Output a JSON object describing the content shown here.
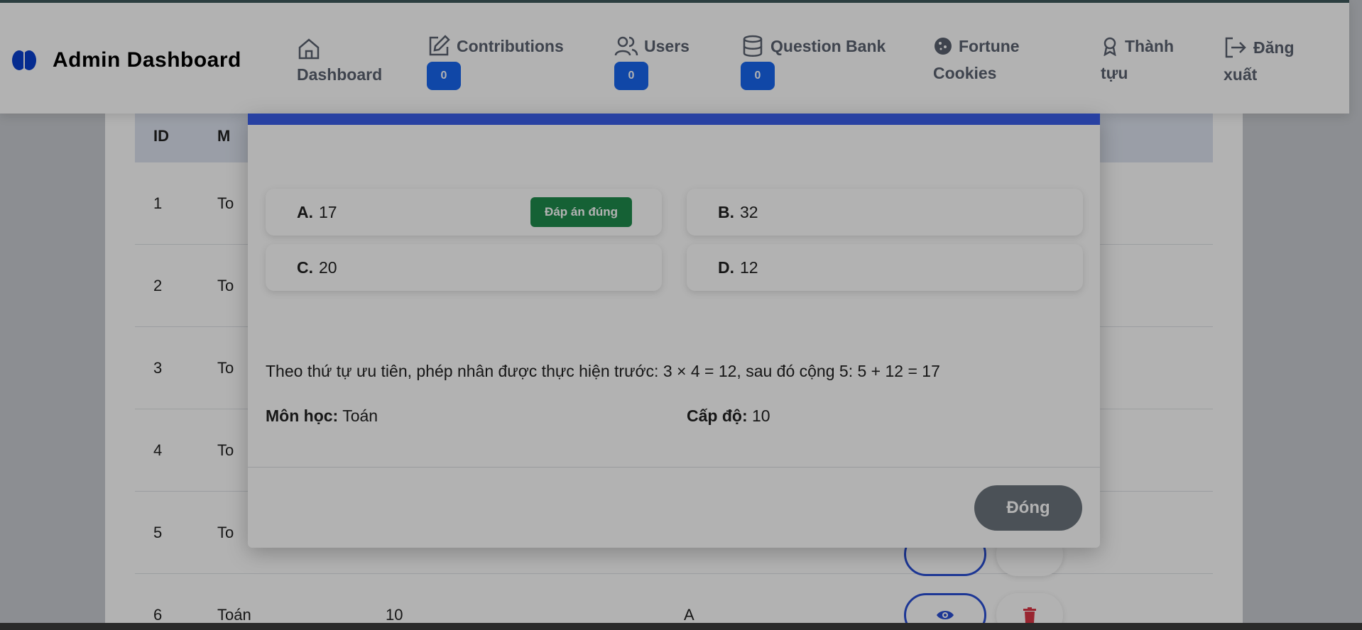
{
  "navbar": {
    "brand_title": "Admin Dashboard",
    "items": [
      {
        "label": "Dashboard",
        "icon": "home-icon"
      },
      {
        "label": "Contributions",
        "icon": "edit-icon",
        "badge": "0"
      },
      {
        "label": "Users",
        "icon": "users-icon",
        "badge": "0"
      },
      {
        "label": "Question Bank",
        "icon": "database-icon",
        "badge": "0"
      },
      {
        "label_line1": "Fortune",
        "label_line2": "Cookies",
        "icon": "cookie-icon"
      },
      {
        "label_line1": "Thành",
        "label_line2": "tựu",
        "icon": "award-icon"
      },
      {
        "label_line1": "Đăng",
        "label_line2": "xuất",
        "icon": "logout-icon"
      }
    ]
  },
  "table": {
    "header_id": "ID",
    "header_col2_partial": "M",
    "rows": [
      {
        "id": "1",
        "subject_partial": "To"
      },
      {
        "id": "2",
        "subject_partial": "To"
      },
      {
        "id": "3",
        "subject_partial": "To"
      },
      {
        "id": "4",
        "subject_partial": "To"
      },
      {
        "id": "5",
        "subject_partial": "To"
      },
      {
        "id": "6",
        "subject": "Toán",
        "level": "10",
        "answer": "A"
      }
    ]
  },
  "modal": {
    "options": [
      {
        "key": "A.",
        "value": "17",
        "correct": true
      },
      {
        "key": "B.",
        "value": "32",
        "correct": false
      },
      {
        "key": "C.",
        "value": "20",
        "correct": false
      },
      {
        "key": "D.",
        "value": "12",
        "correct": false
      }
    ],
    "correct_badge": "Đáp án đúng",
    "explanation": "Theo thứ tự ưu tiên, phép nhân được thực hiện trước: 3 × 4 = 12, sau đó cộng 5: 5 + 12 = 17",
    "subject_label": "Môn học:",
    "subject_value": "Toán",
    "level_label": "Cấp độ:",
    "level_value": "10",
    "close_label": "Đóng"
  },
  "colors": {
    "accent_blue": "#3a5de8",
    "badge_blue": "#1866f0",
    "correct_green": "#1f8b4c",
    "close_gray": "#6c757d",
    "delete_red": "#dc3545"
  }
}
